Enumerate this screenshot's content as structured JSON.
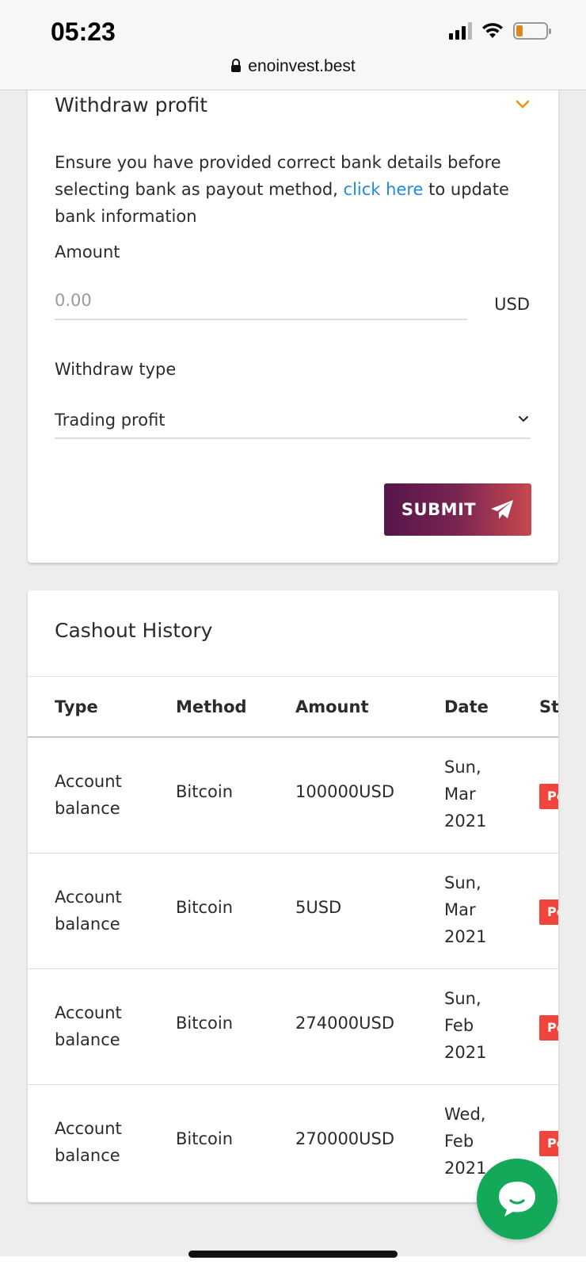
{
  "status_bar": {
    "time": "05:23"
  },
  "browser": {
    "url": "enoinvest.best"
  },
  "withdraw_card": {
    "title": "Withdraw profit",
    "notice_before": "Ensure you have provided correct bank details before selecting bank as payout method, ",
    "notice_link": "click here",
    "notice_after": " to update bank information",
    "amount_label": "Amount",
    "amount_placeholder": "0.00",
    "currency": "USD",
    "type_label": "Withdraw type",
    "type_value": "Trading profit",
    "submit_label": "SUBMIT"
  },
  "history": {
    "title": "Cashout History",
    "columns": {
      "type": "Type",
      "method": "Method",
      "amount": "Amount",
      "date": "Date",
      "status": "Status"
    },
    "rows": [
      {
        "type": "Account balance",
        "method": "Bitcoin",
        "amount": "100000USD",
        "date": "Sun, Mar 2021",
        "status": "Pending"
      },
      {
        "type": "Account balance",
        "method": "Bitcoin",
        "amount": "5USD",
        "date": "Sun, Mar 2021",
        "status": "Pending"
      },
      {
        "type": "Account balance",
        "method": "Bitcoin",
        "amount": "274000USD",
        "date": "Sun, Feb 2021",
        "status": "Pending"
      },
      {
        "type": "Account balance",
        "method": "Bitcoin",
        "amount": "270000USD",
        "date": "Wed, Feb 2021",
        "status": "Pending"
      }
    ]
  },
  "colors": {
    "accent_orange": "#e8961e",
    "link_blue": "#1f8ae0",
    "badge_red": "#f0443c",
    "chat_green": "#13a85a"
  },
  "icons": [
    "lock-icon",
    "chevron-down-icon",
    "paper-plane-icon",
    "chat-bubble-icon",
    "wifi-icon",
    "battery-icon",
    "signal-icon"
  ]
}
